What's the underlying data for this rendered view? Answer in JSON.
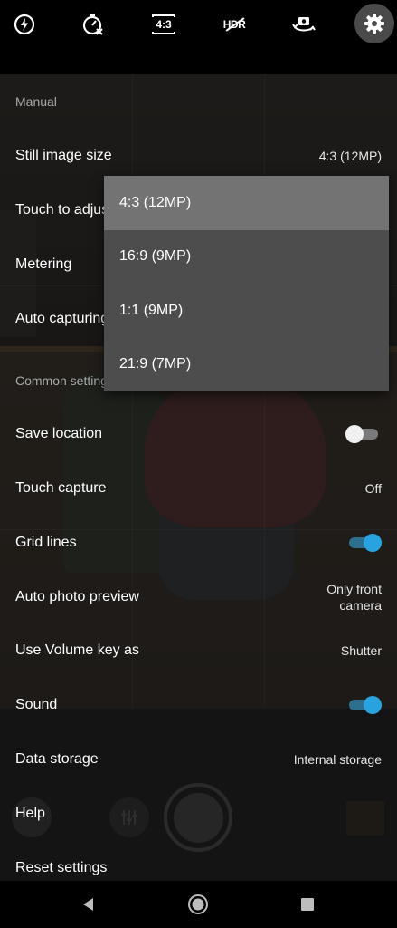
{
  "topbar": {
    "icons": [
      "flash-auto-icon",
      "timer-off-icon",
      "aspect-ratio-icon",
      "hdr-off-icon",
      "switch-camera-icon",
      "gear-icon"
    ],
    "aspect_text": "4:3",
    "hdr_text": "HDR"
  },
  "sections": {
    "manual": "Manual",
    "common": "Common settings"
  },
  "rows": {
    "still_image_size": {
      "label": "Still image size",
      "value": "4:3 (12MP)"
    },
    "touch_to_adjust": {
      "label": "Touch to adjust"
    },
    "metering": {
      "label": "Metering"
    },
    "auto_capturing": {
      "label": "Auto capturing"
    },
    "save_location": {
      "label": "Save location",
      "toggle": false
    },
    "touch_capture": {
      "label": "Touch capture",
      "value": "Off"
    },
    "grid_lines": {
      "label": "Grid lines",
      "toggle": true
    },
    "auto_photo_preview": {
      "label": "Auto photo preview",
      "value_line1": "Only front",
      "value_line2": "camera"
    },
    "volume_key": {
      "label": "Use Volume key as",
      "value": "Shutter"
    },
    "sound": {
      "label": "Sound",
      "toggle": true
    },
    "data_storage": {
      "label": "Data storage",
      "value": "Internal storage"
    },
    "help": {
      "label": "Help"
    },
    "reset_settings": {
      "label": "Reset settings"
    }
  },
  "dropdown": {
    "options": [
      "4:3 (12MP)",
      "16:9 (9MP)",
      "1:1 (9MP)",
      "21:9 (7MP)"
    ],
    "selected": "4:3 (12MP)"
  },
  "colors": {
    "accent": "#29a3e0",
    "dropdown_bg": "#4d4d4d",
    "dropdown_selected": "#737373"
  },
  "navbar": {
    "icons": [
      "back-icon",
      "home-icon",
      "recents-icon"
    ]
  }
}
